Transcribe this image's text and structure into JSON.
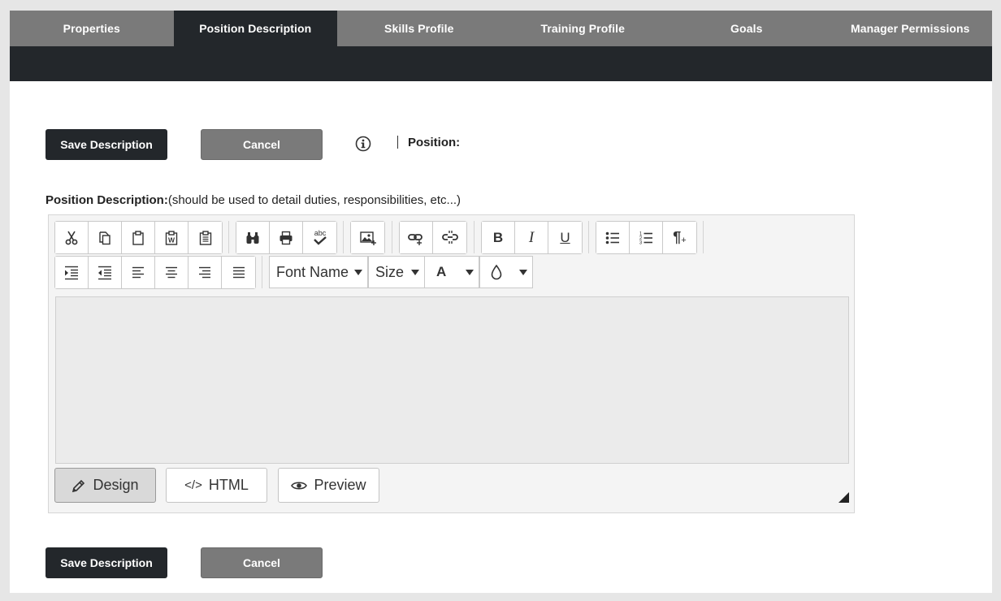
{
  "tabs": [
    {
      "label": "Properties",
      "active": false
    },
    {
      "label": "Position Description",
      "active": true
    },
    {
      "label": "Skills Profile",
      "active": false
    },
    {
      "label": "Training Profile",
      "active": false
    },
    {
      "label": "Goals",
      "active": false
    },
    {
      "label": "Manager Permissions",
      "active": false
    }
  ],
  "actions": {
    "save_label": "Save Description",
    "cancel_label": "Cancel"
  },
  "position": {
    "label": "Position:",
    "info_icon": "info-icon"
  },
  "description": {
    "label": "Position Description:",
    "hint": "(should be used to detail duties, responsibilities, etc...)"
  },
  "editor": {
    "font_name": "Font Name",
    "size": "Size",
    "fore_color_glyph": "A",
    "toolbar_row1": [
      [
        "cut-icon",
        "copy-icon",
        "paste-icon",
        "paste-word-icon",
        "paste-text-icon"
      ],
      [
        "find-icon",
        "print-icon",
        "spellcheck-icon"
      ],
      [
        "insert-image-icon"
      ],
      [
        "insert-link-icon",
        "remove-link-icon"
      ],
      [
        "bold-icon",
        "italic-icon",
        "underline-icon"
      ],
      [
        "bullet-list-icon",
        "numbered-list-icon",
        "paragraph-icon"
      ]
    ],
    "toolbar_row2": [
      "indent-icon",
      "outdent-icon",
      "align-left-icon",
      "align-center-icon",
      "align-right-icon",
      "justify-icon"
    ],
    "spellcheck_text": "abc",
    "bold_glyph": "B",
    "italic_glyph": "I",
    "underline_glyph": "U",
    "paragraph_glyph": "¶",
    "modes": [
      {
        "label": "Design",
        "icon": "pencil-icon",
        "active": true
      },
      {
        "label": "HTML",
        "icon": "code-icon",
        "active": false
      },
      {
        "label": "Preview",
        "icon": "eye-icon",
        "active": false
      }
    ],
    "code_glyph": "</>"
  }
}
